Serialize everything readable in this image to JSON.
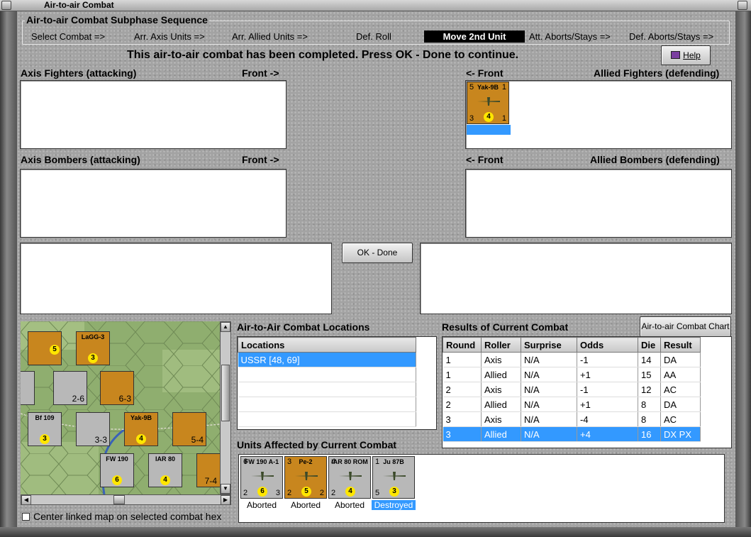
{
  "window": {
    "title": "Air-to-air Combat"
  },
  "sequence": {
    "title": "Air-to-air Combat Subphase Sequence",
    "steps": [
      "Select Combat =>",
      "Arr. Axis Units =>",
      "Arr. Allied Units =>",
      "Def. Roll",
      "Move 2nd Unit",
      "Att. Aborts/Stays =>",
      "Def. Aborts/Stays =>"
    ],
    "active_step": "Move 2nd Unit"
  },
  "status_message": "This air-to-air combat has been completed.  Press OK - Done to continue.",
  "help_button": "Help",
  "ok_button": "OK - Done",
  "chart_button": "Air-to-air Combat Chart",
  "boxes": {
    "axis_fighters": "Axis Fighters (attacking)",
    "axis_bombers": "Axis Bombers (attacking)",
    "allied_fighters": "Allied Fighters (defending)",
    "allied_bombers": "Allied Bombers (defending)",
    "front_right": "Front ->",
    "front_left": "<- Front"
  },
  "allied_fighter_unit": {
    "name": "Yak-9B",
    "tl": "5",
    "tr": "1",
    "bl": "3",
    "br": "1",
    "die": "4"
  },
  "locations": {
    "title": "Air-to-Air Combat Locations",
    "header": "Locations",
    "items": [
      "USSR [48, 69]"
    ]
  },
  "results": {
    "title": "Results of Current Combat",
    "columns": [
      "Round",
      "Roller",
      "Surprise",
      "Odds",
      "Die",
      "Result"
    ],
    "rows": [
      [
        "1",
        "Axis",
        "N/A",
        "-1",
        "14",
        "DA"
      ],
      [
        "1",
        "Allied",
        "N/A",
        "+1",
        "15",
        "AA"
      ],
      [
        "2",
        "Axis",
        "N/A",
        "-1",
        "12",
        "AC"
      ],
      [
        "2",
        "Allied",
        "N/A",
        "+1",
        "8",
        "DA"
      ],
      [
        "3",
        "Axis",
        "N/A",
        "-4",
        "8",
        "AC"
      ],
      [
        "3",
        "Allied",
        "N/A",
        "+4",
        "16",
        "DX PX"
      ]
    ],
    "selected_row": 5
  },
  "affected": {
    "title": "Units Affected by Current Combat",
    "units": [
      {
        "name": "FW 190 A-1",
        "tl": "6",
        "bl": "2",
        "br": "3",
        "die": "6",
        "status": "Aborted",
        "color": "#b8b8b8"
      },
      {
        "name": "Pe-2",
        "tl": "3",
        "bl": "2",
        "br": "2",
        "die": "5",
        "status": "Aborted",
        "color": "#c8861e"
      },
      {
        "name": "IAR 80 ROM",
        "tl": "4",
        "bl": "2",
        "br": "",
        "die": "4",
        "status": "Aborted",
        "color": "#b8b8b8"
      },
      {
        "name": "Ju 87B",
        "tl": "1",
        "bl": "5",
        "br": "",
        "die": "3",
        "status": "Destroyed",
        "color": "#b8b8b8"
      }
    ]
  },
  "map_checkbox": "Center linked map on selected combat hex",
  "map_units": [
    {
      "name": "LaGG-3",
      "value": "3"
    },
    {
      "name": "Bf 109",
      "value": "3"
    },
    {
      "name": "Yak-9B",
      "value": "4"
    },
    {
      "name": "FW 190",
      "value": "6"
    },
    {
      "name": "IAR 80",
      "value": "4"
    },
    {
      "name": "6-3",
      "value": ""
    },
    {
      "name": "2-6",
      "value": ""
    },
    {
      "name": "3-3",
      "value": ""
    },
    {
      "name": "5-4",
      "value": ""
    },
    {
      "name": "7-4",
      "value": ""
    }
  ],
  "colors": {
    "selection": "#3399ff",
    "unit_orange": "#c8861e",
    "unit_grey": "#b8b8b8"
  }
}
